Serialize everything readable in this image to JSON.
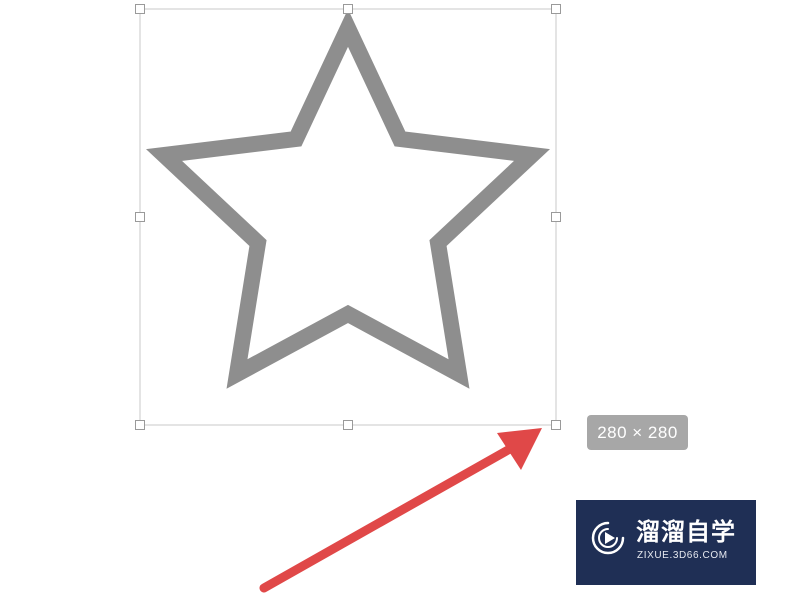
{
  "selection": {
    "size_label": "280 × 280"
  },
  "watermark": {
    "brand_text": "溜溜自学",
    "url_text": "ZIXUE.3D66.COM"
  },
  "colors": {
    "star_stroke": "#8e8e8e",
    "selection_border": "#c8c8c8",
    "handle_border": "#9a9a9a",
    "badge_bg": "#a7a7a7",
    "arrow": "#e04848",
    "watermark_bg": "#1f2f55"
  },
  "icons": {
    "shape": "star-outline-icon",
    "logo": "play-logo-icon"
  }
}
